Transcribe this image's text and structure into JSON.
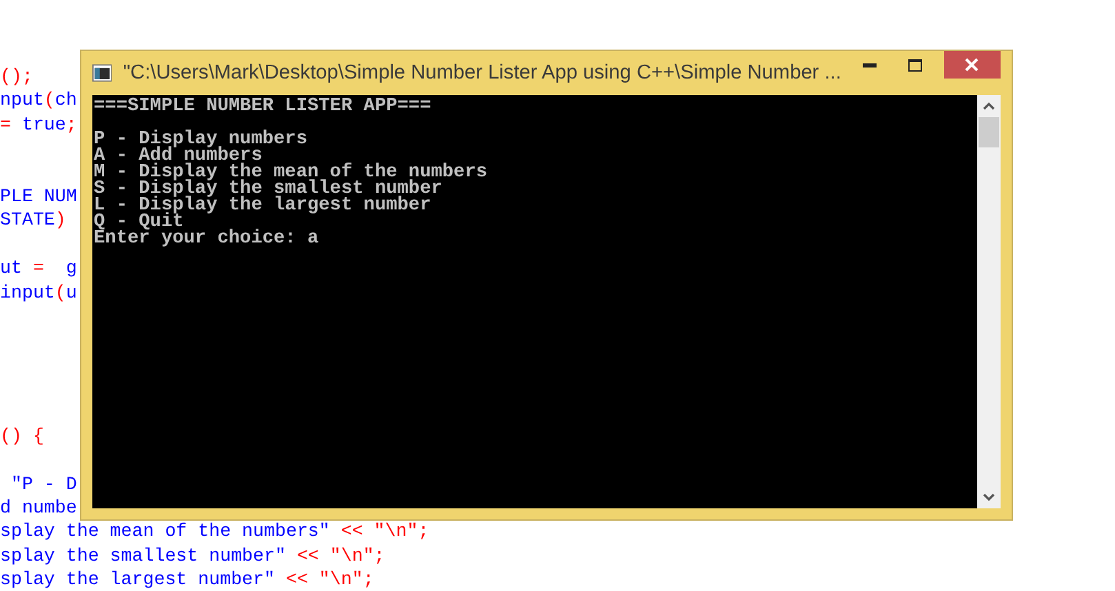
{
  "code_editor": {
    "lines": [
      {
        "kind": "code",
        "segments": [
          {
            "text": "();",
            "color": "#ff0000"
          }
        ]
      },
      {
        "kind": "code",
        "segments": [
          {
            "text": "nput",
            "color": "#0000ff"
          },
          {
            "text": "(",
            "color": "#ff0000"
          },
          {
            "text": "ch",
            "color": "#0000ff"
          }
        ]
      },
      {
        "kind": "code",
        "segments": [
          {
            "text": "=",
            "color": "#ff0000"
          },
          {
            "text": " true",
            "color": "#0000ff"
          },
          {
            "text": ";",
            "color": "#ff0000"
          }
        ]
      },
      {
        "kind": "blank"
      },
      {
        "kind": "blank"
      },
      {
        "kind": "code",
        "segments": [
          {
            "text": "PLE NUM",
            "color": "#0000ff"
          }
        ]
      },
      {
        "kind": "code",
        "segments": [
          {
            "text": "STATE",
            "color": "#0000ff"
          },
          {
            "text": ")",
            "color": "#ff0000"
          }
        ]
      },
      {
        "kind": "blank"
      },
      {
        "kind": "code",
        "segments": [
          {
            "text": "ut",
            "color": "#0000ff"
          },
          {
            "text": " =",
            "color": "#ff0000"
          },
          {
            "text": "  g",
            "color": "#0000ff"
          }
        ]
      },
      {
        "kind": "code",
        "segments": [
          {
            "text": "input",
            "color": "#0000ff"
          },
          {
            "text": "(",
            "color": "#ff0000"
          },
          {
            "text": "u",
            "color": "#0000ff"
          }
        ]
      },
      {
        "kind": "blank"
      },
      {
        "kind": "blank"
      },
      {
        "kind": "blank"
      },
      {
        "kind": "blank"
      },
      {
        "kind": "blank"
      },
      {
        "kind": "code",
        "segments": [
          {
            "text": "() {",
            "color": "#ff0000"
          }
        ]
      },
      {
        "kind": "blank"
      },
      {
        "kind": "code",
        "segments": [
          {
            "text": " \"P - D",
            "color": "#0000ff"
          }
        ]
      },
      {
        "kind": "code",
        "segments": [
          {
            "text": "d numbe",
            "color": "#0000ff"
          }
        ]
      },
      {
        "kind": "code",
        "segments": [
          {
            "text": "splay the mean of the numbers\"",
            "color": "#0000ff"
          },
          {
            "text": " << \"\\n\";",
            "color": "#ff0000"
          }
        ]
      },
      {
        "kind": "code",
        "segments": [
          {
            "text": "splay the smallest number\"",
            "color": "#0000ff"
          },
          {
            "text": " << \"\\n\";",
            "color": "#ff0000"
          }
        ]
      },
      {
        "kind": "code",
        "segments": [
          {
            "text": "splay the largest number\"",
            "color": "#0000ff"
          },
          {
            "text": " << \"\\n\";",
            "color": "#ff0000"
          }
        ]
      }
    ]
  },
  "console_window": {
    "title": "\"C:\\Users\\Mark\\Desktop\\Simple Number Lister App using C++\\Simple Number ...",
    "lines": [
      {
        "kind": "text",
        "text": "===SIMPLE NUMBER LISTER APP==="
      },
      {
        "kind": "blank"
      },
      {
        "kind": "text",
        "text": "P - Display numbers"
      },
      {
        "kind": "text",
        "text": "A - Add numbers"
      },
      {
        "kind": "text",
        "text": "M - Display the mean of the numbers"
      },
      {
        "kind": "text",
        "text": "S - Display the smallest number"
      },
      {
        "kind": "text",
        "text": "L - Display the largest number"
      },
      {
        "kind": "text",
        "text": "Q - Quit"
      },
      {
        "kind": "text",
        "text": "Enter your choice: a"
      }
    ]
  }
}
